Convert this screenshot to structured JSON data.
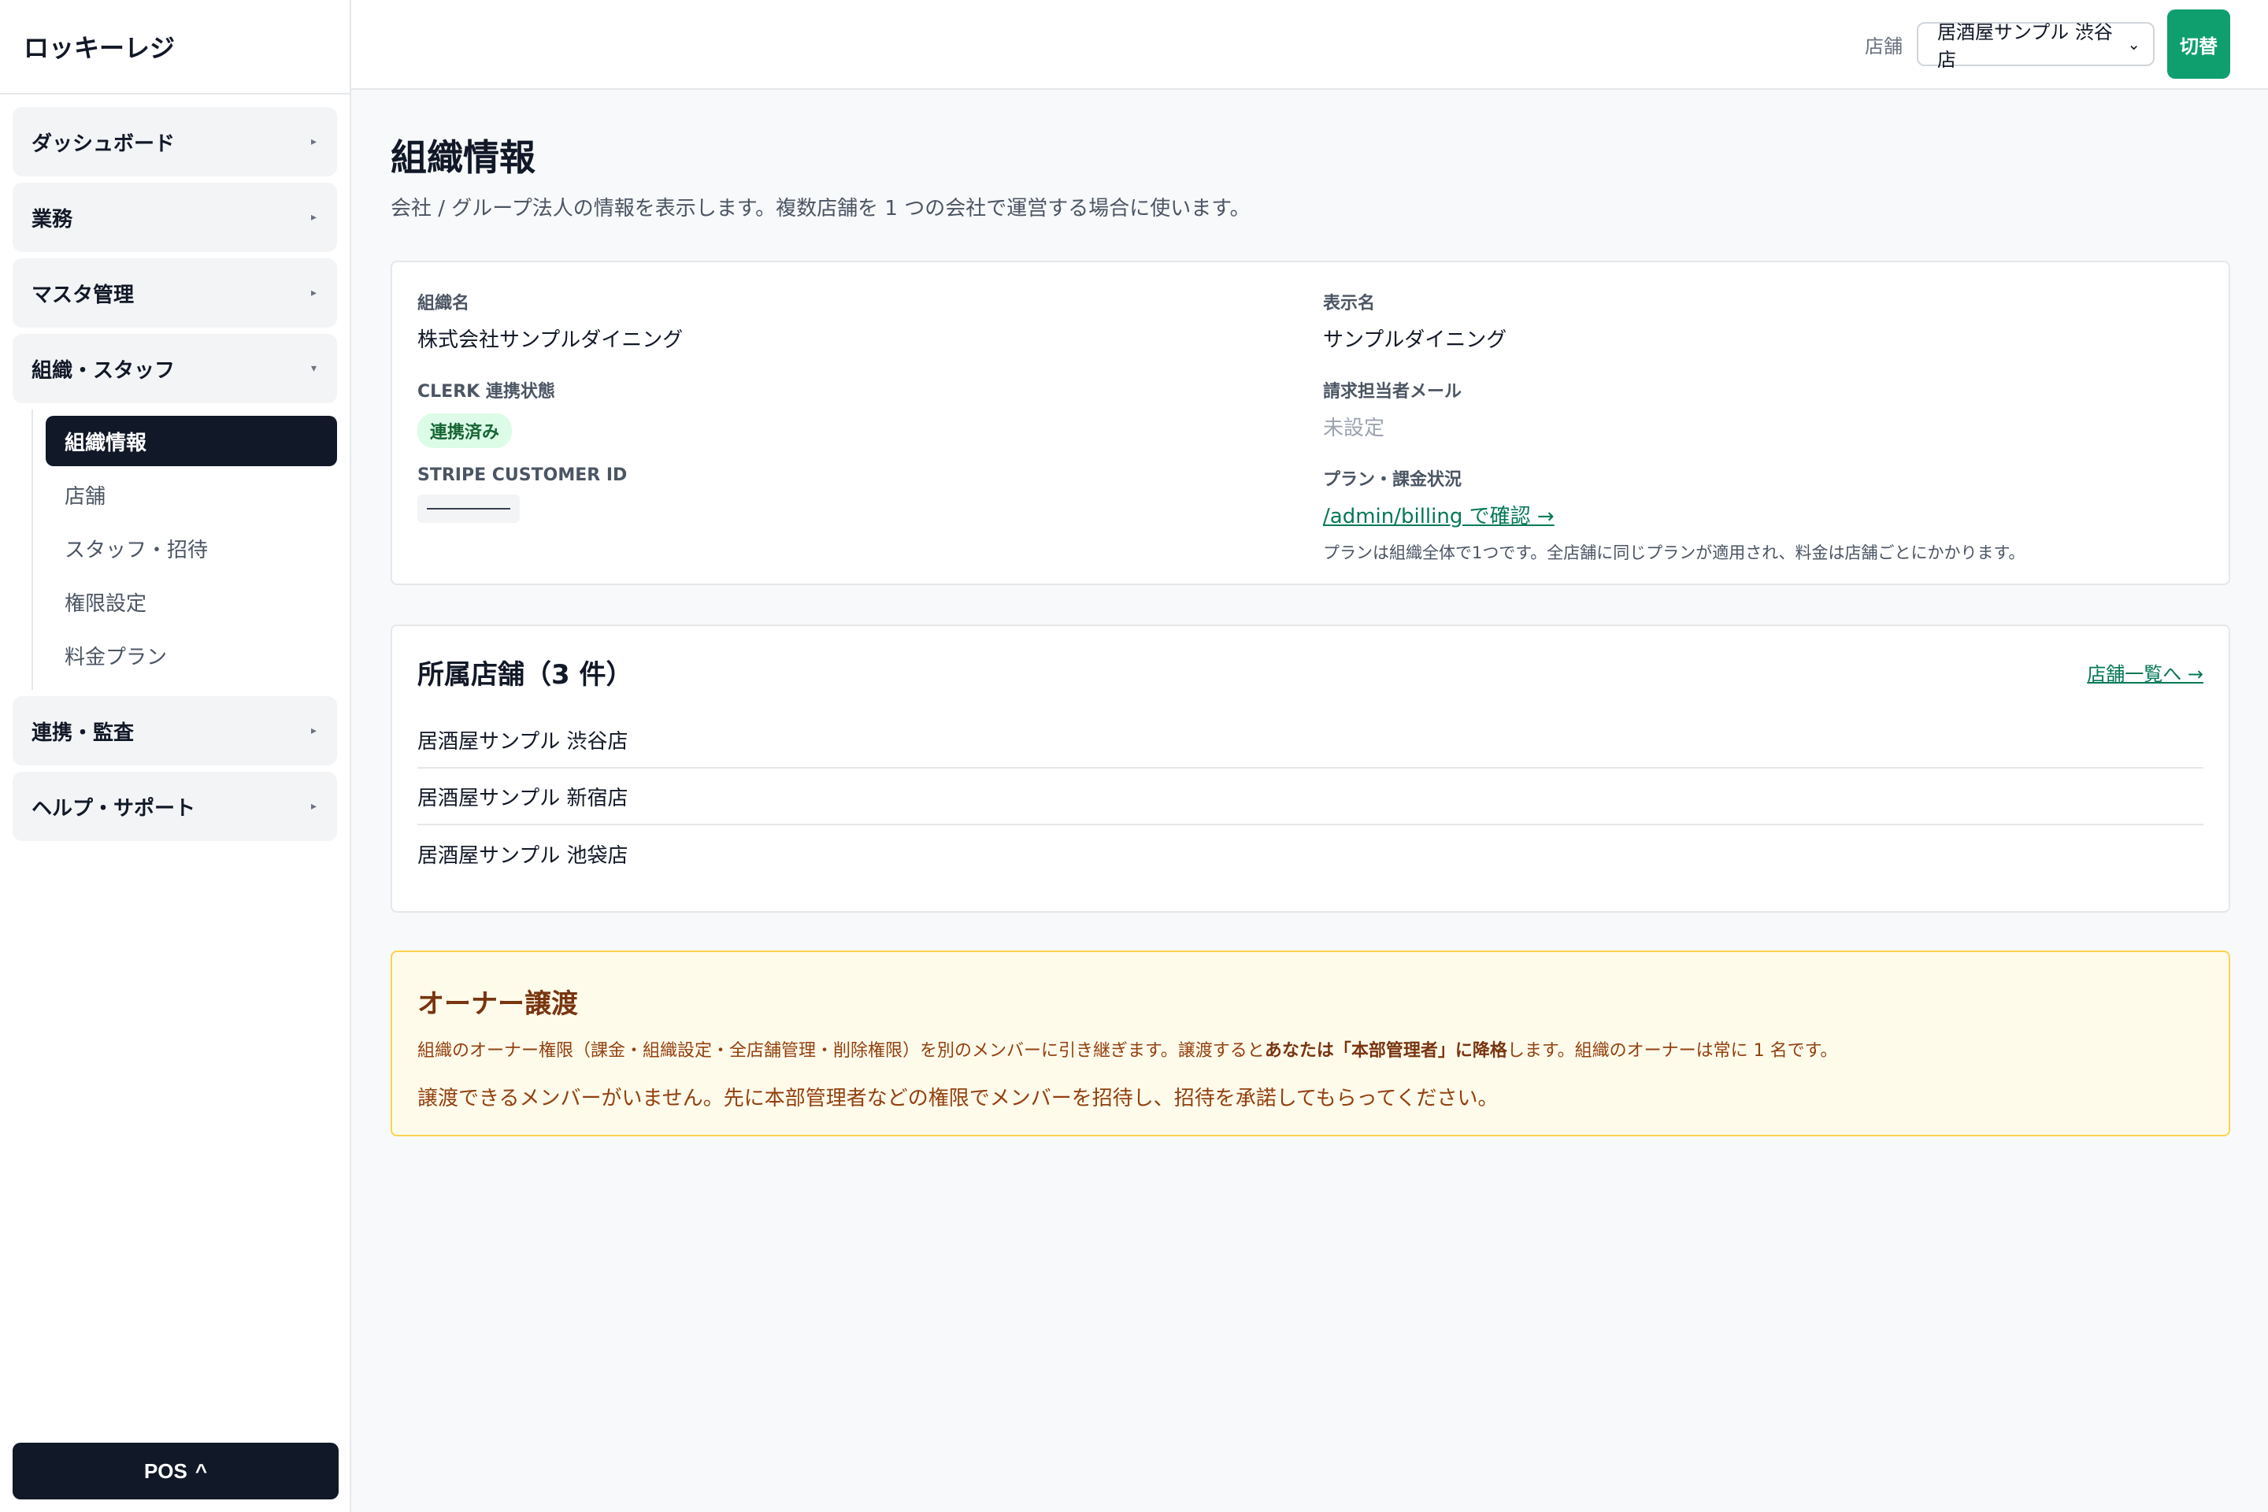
{
  "app": {
    "name": "ロッキーレジ"
  },
  "sidebar": {
    "groups": [
      {
        "label": "ダッシュボード",
        "caret": "▸"
      },
      {
        "label": "業務",
        "caret": "▸"
      },
      {
        "label": "マスタ管理",
        "caret": "▸"
      },
      {
        "label": "組織・スタッフ",
        "caret": "▾"
      },
      {
        "label": "連携・監査",
        "caret": "▸"
      },
      {
        "label": "ヘルプ・サポート",
        "caret": "▸"
      }
    ],
    "subitems": [
      {
        "label": "組織情報",
        "active": true
      },
      {
        "label": "店舗"
      },
      {
        "label": "スタッフ・招待"
      },
      {
        "label": "権限設定"
      },
      {
        "label": "料金プラン"
      }
    ],
    "pos_button": {
      "label": "POS",
      "icon": "^"
    }
  },
  "topbar": {
    "store_label": "店舗",
    "store_selected": "居酒屋サンプル 渋谷店",
    "switch_label": "切替"
  },
  "page": {
    "title": "組織情報",
    "description": "会社 / グループ法人の情報を表示します。複数店舗を 1 つの会社で運営する場合に使います。"
  },
  "org": {
    "name_label": "組織名",
    "name_value": "株式会社サンプルダイニング",
    "display_label": "表示名",
    "display_value": "サンプルダイニング",
    "clerk_label": "CLERK 連携状態",
    "clerk_value": "連携済み",
    "billing_email_label": "請求担当者メール",
    "billing_email_value": "未設定",
    "stripe_label": "STRIPE CUSTOMER ID",
    "plan_label": "プラン・課金状況",
    "plan_link": "/admin/billing で確認 →",
    "plan_note": "プランは組織全体で1つです。全店舗に同じプランが適用され、料金は店舗ごとにかかります。"
  },
  "stores": {
    "title": "所属店舗（3 件）",
    "link": "店舗一覧へ →",
    "items": [
      "居酒屋サンプル 渋谷店",
      "居酒屋サンプル 新宿店",
      "居酒屋サンプル 池袋店"
    ]
  },
  "transfer": {
    "title": "オーナー譲渡",
    "desc_part1": "組織のオーナー権限（課金・組織設定・全店舗管理・削除権限）を別のメンバーに引き継ぎます。譲渡すると",
    "desc_bold1": "あなたは「本部管理者」に降格",
    "desc_part2": "します。組織のオーナーは常に 1 名です。",
    "message": "譲渡できるメンバーがいません。先に本部管理者などの権限でメンバーを招待し、招待を承諾してもらってください。"
  },
  "colors": {
    "sidebar_active": "#111827",
    "accent_green": "#0f9f6e",
    "link_green": "#047857",
    "badge_bg": "#dcfce7",
    "warn_bg": "#fffbeb",
    "warn_border": "#fcd34d"
  }
}
